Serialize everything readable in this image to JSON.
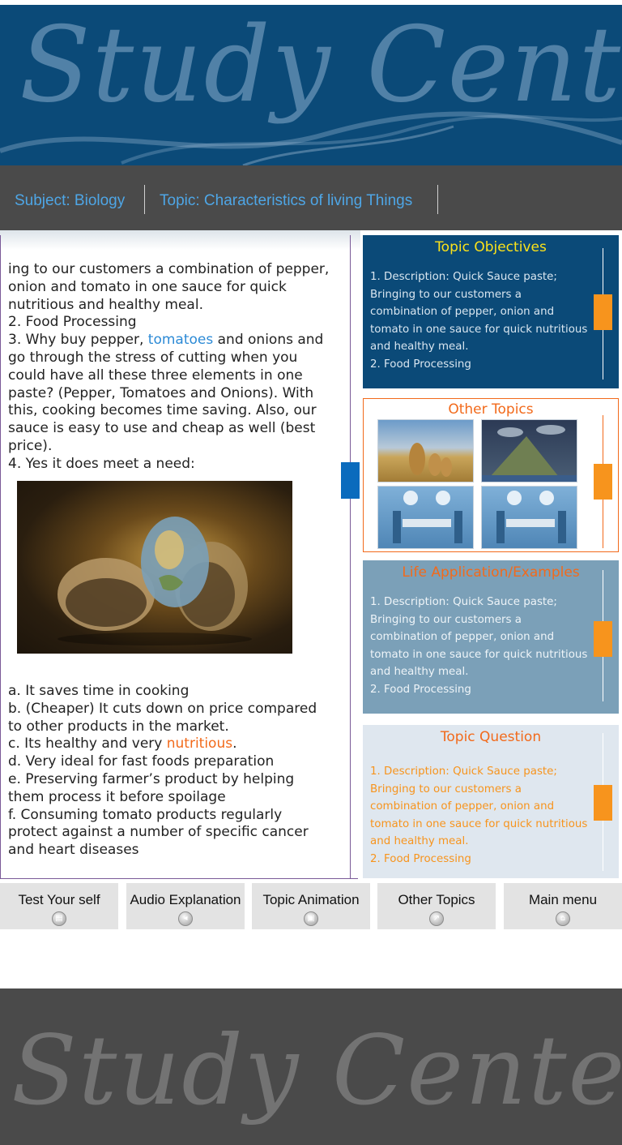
{
  "header": {
    "logo_text": "Study Center"
  },
  "nav": {
    "subject": "Subject: Biology",
    "topic": "Topic: Characteristics of living Things"
  },
  "content": {
    "para1": "ing to our customers a combination of pepper, onion and tomato in one sauce for quick nutritious and healthy meal.",
    "item2": "2.   Food Processing",
    "item3_pre": "3.   Why buy pepper, ",
    "item3_link": "tomatoes",
    "item3_post": " and onions and go through the stress of cutting when you could have all these three elements in one paste? (Pepper, Tomatoes and Onions). With this, cooking becomes time saving. Also, our sauce is easy to use and cheap as well (best price).",
    "item4": "4.   Yes it does meet a need:",
    "image_name": "egg-globe-image",
    "list_a": "a.   It saves time in cooking",
    "list_b": "b.   (Cheaper) It cuts down on price compared to other products in the market.",
    "list_c_pre": "c.   Its healthy and very ",
    "list_c_link": "nutritious",
    "list_c_post": ".",
    "list_d": "d.   Very ideal for fast foods preparation",
    "list_e": "e.   Preserving farmer’s product by helping them process it before spoilage",
    "list_f": "f.   Consuming tomato products regularly protect against a number of specific cancer and heart diseases"
  },
  "panels": {
    "objectives": {
      "title": "Topic Objectives",
      "line1": "1.     Description: Quick Sauce paste; Bringing to our customers a combination of pepper, onion and tomato in one sauce for quick nutritious and healthy meal.",
      "line2": "2.     Food Processing"
    },
    "other_topics": {
      "title": "Other Topics",
      "thumbs": [
        "cheetah-family-image",
        "water-cycle-diagram-image",
        "operating-room-image",
        "operating-room-image"
      ]
    },
    "life_application": {
      "title": "Life Application/Examples",
      "line1": "1.     Description: Quick Sauce paste; Bringing to our customers a combination of pepper, onion and tomato in one sauce for quick nutritious and healthy meal.",
      "line2": "2.     Food Processing"
    },
    "question": {
      "title": "Topic Question",
      "line1": "1.     Description: Quick Sauce paste; Bringing to our customers a combination of pepper, onion and tomato in one sauce for quick nutritious and healthy meal.",
      "line2": "2.     Food Processing"
    }
  },
  "tabs": [
    {
      "label": "Test Your self",
      "icon": "doc-icon"
    },
    {
      "label": "Audio Explanation",
      "icon": "speaker-icon"
    },
    {
      "label": "Topic Animation",
      "icon": "film-icon"
    },
    {
      "label": "Other Topics",
      "icon": "arrow-icon"
    },
    {
      "label": "Main menu",
      "icon": "home-icon"
    }
  ],
  "footer": {
    "logo_text": "Study Center"
  },
  "colors": {
    "banner_blue": "#0b4a78",
    "nav_gray": "#4a4a4a",
    "accent_orange": "#f26a1b",
    "link_blue": "#4ea6e6"
  }
}
